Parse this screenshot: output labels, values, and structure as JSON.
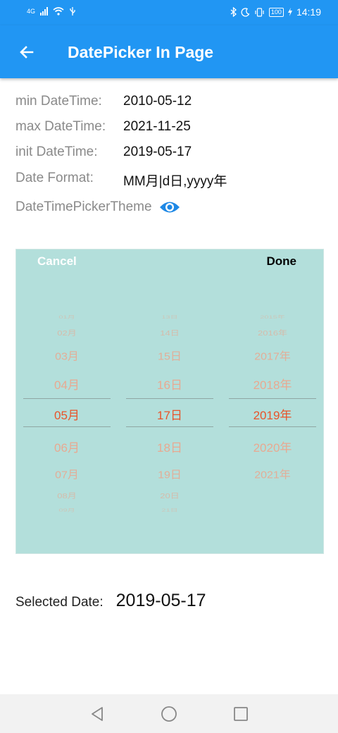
{
  "status_bar": {
    "network_label": "4G",
    "time": "14:19",
    "battery": "100",
    "icons": [
      "signal-icon",
      "wifi-icon",
      "usb-icon",
      "bluetooth-icon",
      "moon-icon",
      "vibrate-icon",
      "battery-icon",
      "charging-icon"
    ]
  },
  "app_bar": {
    "title": "DatePicker In Page",
    "back_icon": "arrow-back-icon",
    "color": "#2196f3"
  },
  "info": {
    "min_label": "min DateTime:",
    "min_value": "2010-05-12",
    "max_label": "max DateTime:",
    "max_value": "2021-11-25",
    "init_label": "init DateTime:",
    "init_value": "2019-05-17",
    "format_label": "Date Format:",
    "format_value": "MM月|d日,yyyy年",
    "theme_label": "DateTimePickerTheme",
    "theme_icon": "eye-icon"
  },
  "picker": {
    "cancel_label": "Cancel",
    "done_label": "Done",
    "background": "#b3dfdb",
    "selected_color": "#e8542a",
    "month_items": [
      "01月",
      "02月",
      "03月",
      "04月",
      "05月",
      "06月",
      "07月",
      "08月",
      "09月"
    ],
    "day_items": [
      "13日",
      "14日",
      "15日",
      "16日",
      "17日",
      "18日",
      "19日",
      "20日",
      "21日"
    ],
    "year_items": [
      "2015年",
      "2016年",
      "2017年",
      "2018年",
      "2019年",
      "2020年",
      "2021年",
      "",
      ""
    ],
    "selected_month": "05月",
    "selected_day": "17日",
    "selected_year": "2019年"
  },
  "selected": {
    "label": "Selected Date:",
    "value": "2019-05-17"
  },
  "nav": {
    "icons": [
      "back-triangle-icon",
      "home-circle-icon",
      "recents-square-icon"
    ]
  }
}
